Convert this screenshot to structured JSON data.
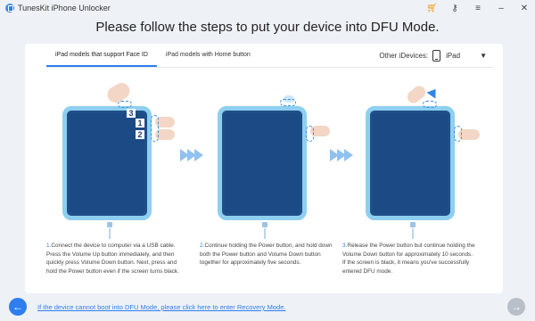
{
  "app": {
    "title": "TunesKit iPhone Unlocker"
  },
  "window_controls": [
    "cart-icon",
    "key-icon",
    "menu-icon",
    "minimize-icon",
    "close-icon"
  ],
  "heading": "Please follow the steps to put your device into DFU Mode.",
  "tabs": [
    {
      "label": "iPad models that support Face ID",
      "active": true
    },
    {
      "label": "iPad models with Home button",
      "active": false
    }
  ],
  "other_devices": {
    "label": "Other iDevices:",
    "selected": "iPad"
  },
  "steps": [
    {
      "num": "1.",
      "text": "Connect the device to computer via a USB cable. Press the Volume Up button immediately, and then quickly press Volume Down button. Next, press and hold the Power button even if the screen turns black.",
      "badges": [
        "3",
        "1",
        "2"
      ]
    },
    {
      "num": "2.",
      "text": "Continue holding the Power button, and hold down both the Power button and Volume Down button together for approximately five seconds."
    },
    {
      "num": "3.",
      "text": "Release the Power button but continue holding the Volume Down button for approximately 10 seconds. If the screen is black, it means you've successfully entered DFU mode."
    }
  ],
  "footer": {
    "recovery_link": "If the device cannot boot into DFU Mode, please click here to enter Recovery Mode."
  },
  "colors": {
    "accent": "#2e7ef0",
    "device_frame": "#8ecff0",
    "device_screen": "#1c4a85"
  }
}
